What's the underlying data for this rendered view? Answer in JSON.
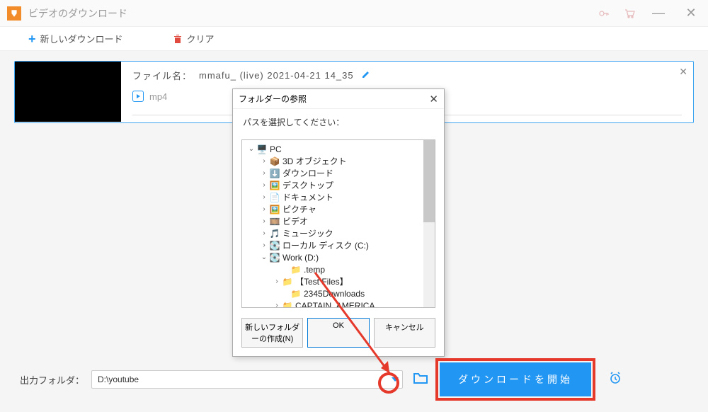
{
  "titlebar": {
    "title": "ビデオのダウンロード"
  },
  "toolbar": {
    "new_download": "新しいダウンロード",
    "clear": "クリア"
  },
  "item": {
    "filename_label": "ファイル名：",
    "filename": "mmafu_ (live) 2021-04-21 14_35",
    "format": "mp4",
    "size_sep": "- -"
  },
  "dialog": {
    "title": "フォルダーの参照",
    "subtitle": "パスを選択してください：",
    "new_folder": "新しいフォルダーの作成(N)",
    "ok": "OK",
    "cancel": "キャンセル",
    "tree": {
      "pc": "PC",
      "objects3d": "3D オブジェクト",
      "downloads": "ダウンロード",
      "desktop": "デスクトップ",
      "documents": "ドキュメント",
      "pictures": "ピクチャ",
      "videos": "ビデオ",
      "music": "ミュージック",
      "local_c": "ローカル ディスク (C:)",
      "work_d": "Work (D:)",
      "temp": ".temp",
      "test_files": "【Test Files】",
      "dl2345": "2345Downloads",
      "captain": "CAPTAIN_AMERICA"
    }
  },
  "bottom": {
    "label": "出力フォルダ：",
    "path": "D:\\youtube",
    "start": "ダウンロードを開始"
  }
}
